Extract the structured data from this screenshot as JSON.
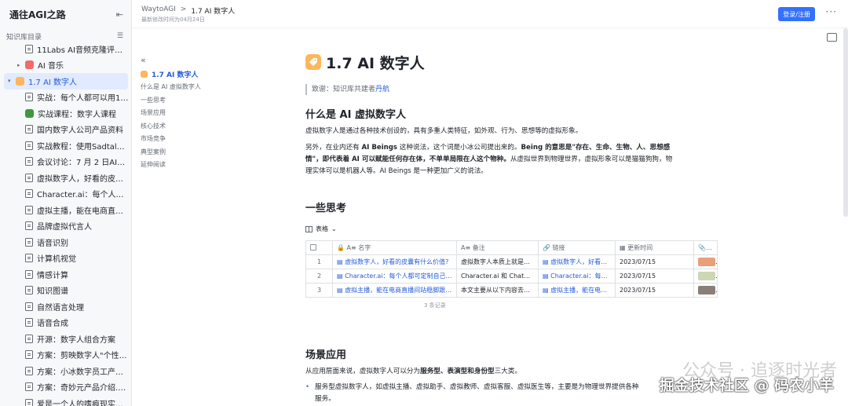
{
  "sidebar": {
    "title": "通往AGI之路",
    "subtitle": "知识库目录",
    "items": [
      {
        "label": "11Labs AI音频克隆评测…",
        "level": "child",
        "icon": "doc"
      },
      {
        "label": "AI 音乐",
        "level": "lvl1",
        "icon": "emoji",
        "icon_color": "#f26b6b",
        "caret": "▸"
      },
      {
        "label": "1.7 AI 数字人",
        "level": "lvl0",
        "icon": "emoji",
        "icon_color": "#ffb65c",
        "caret": "▾",
        "active": true
      },
      {
        "label": "实战：每个人都可以用10分…",
        "level": "child",
        "icon": "doc"
      },
      {
        "label": "实战课程：数字人课程",
        "level": "child",
        "icon": "emoji",
        "icon_color": "#3c9a3c"
      },
      {
        "label": "国内数字人公司产品资料",
        "level": "child",
        "icon": "doc"
      },
      {
        "label": "实战教程：使用Sadtalker让照…",
        "level": "child",
        "icon": "doc"
      },
      {
        "label": "会议讨论：7 月 2 日AI数字人…",
        "level": "child",
        "icon": "doc"
      },
      {
        "label": "虚拟数字人，好看的皮囊有什…",
        "level": "child",
        "icon": "doc"
      },
      {
        "label": "Character.ai：每个人都可定制…",
        "level": "child",
        "icon": "doc"
      },
      {
        "label": "虚拟主播，能在电商直播间站…",
        "level": "child",
        "icon": "doc"
      },
      {
        "label": "品牌虚拟代言人",
        "level": "child",
        "icon": "doc"
      },
      {
        "label": "语音识别",
        "level": "child",
        "icon": "doc"
      },
      {
        "label": "计算机视觉",
        "level": "child",
        "icon": "doc"
      },
      {
        "label": "情感计算",
        "level": "child",
        "icon": "doc"
      },
      {
        "label": "知识图谱",
        "level": "child",
        "icon": "doc"
      },
      {
        "label": "自然语言处理",
        "level": "child",
        "icon": "doc"
      },
      {
        "label": "语音合成",
        "level": "child",
        "icon": "doc"
      },
      {
        "label": "开源：数字人组合方案",
        "level": "child",
        "icon": "doc"
      },
      {
        "label": "方案：剪映数字人\"个性化\"—…",
        "level": "child",
        "icon": "doc"
      },
      {
        "label": "方案：小冰数字员工产品方案…",
        "level": "child",
        "icon": "doc"
      },
      {
        "label": "方案：奇妙元产品介绍.pptx",
        "level": "child",
        "icon": "doc"
      },
      {
        "label": "爱是一个人的嗜痕现实｜Love …",
        "level": "child",
        "icon": "doc"
      }
    ]
  },
  "topbar": {
    "crumb_root": "WaytoAGI",
    "crumb_sep": ">",
    "crumb_current": "1.7 AI 数字人",
    "modified": "最新修改时间为04月24日",
    "login": "登录/注册",
    "more": "···"
  },
  "toc": {
    "items": [
      {
        "label": "1.7 AI 数字人",
        "active": true
      },
      {
        "label": "什么是 AI 虚拟数字人"
      },
      {
        "label": "一些思考"
      },
      {
        "label": "场景应用"
      },
      {
        "label": "核心技术"
      },
      {
        "label": "市场竞争"
      },
      {
        "label": "典型案例"
      },
      {
        "label": "延伸阅读"
      }
    ]
  },
  "doc": {
    "title": "1.7 AI 数字人",
    "thanks_prefix": "致谢：知识库共建者",
    "thanks_name": "丹航",
    "h_what": "什么是 AI 虚拟数字人",
    "p1": "虚拟数字人是通过各种技术创设的，具有多重人类特征，如外观、行为、思想等的虚拟形象。",
    "p2a": "另外，在业内还有",
    "p2b": "AI Beings",
    "p2c": "这种说法，这个词是小冰公司提出来的。",
    "p2d": "Being 的意思是\"存在、生命、生物、人、思想感情\"，即代表着 AI 可以赋能任何存在体，不单单局限在人这个物种。",
    "p2e": "从虚拟世界到物理世界，虚拟形象可以是猫猫狗狗，物理实体可以是机器人等。AI Beings 是一种更加广义的说法。",
    "h_think": "一些思考",
    "table_view": "表格",
    "table_headers": [
      "名字",
      "备注",
      "链接",
      "更新时间",
      "附件"
    ],
    "table_rows": [
      {
        "n": "1",
        "name": "虚拟数字人，好看的皮囊有什么价值?",
        "note": "虚拟数字人本质上就是…",
        "link": "虚拟数字人，好看的…",
        "date": "2023/07/15",
        "thumb": "#e9a07a"
      },
      {
        "n": "2",
        "name": "Character.ai：每个人都可定制自己的…",
        "note": "Character.ai 和 ChatGPT…",
        "link": "Character.ai：每个人…",
        "date": "2023/07/15",
        "thumb": "#cdd7b4"
      },
      {
        "n": "3",
        "name": "虚拟主播，能在电商直播间站稳脚跟…",
        "note": "本文主要从以下内容去…",
        "link": "虚拟主播，能在电商…",
        "date": "2023/07/15",
        "thumb": "#8a7f78"
      }
    ],
    "record_count": "3 条记录",
    "h_scene": "场景应用",
    "p3a": "从应用层面来说，虚拟数字人可以分为",
    "p3b": "服务型、表演型和身份型",
    "p3c": "三大类。",
    "bullet1": "服务型虚拟数字人，如虚拟主播、虚拟助手、虚拟教师、虚拟客服、虚拟医生等，主要是为物理世界提供各种",
    "bullet1b": "服务。"
  },
  "watermark": {
    "line1": "公众号 · 追逐时光者",
    "line2": "掘金技术社区 @ 码农小羊"
  },
  "colors": {
    "accent": "#3370ff",
    "active_bg": "#e1eaff",
    "sidebar_bg": "#f7f8fa"
  }
}
